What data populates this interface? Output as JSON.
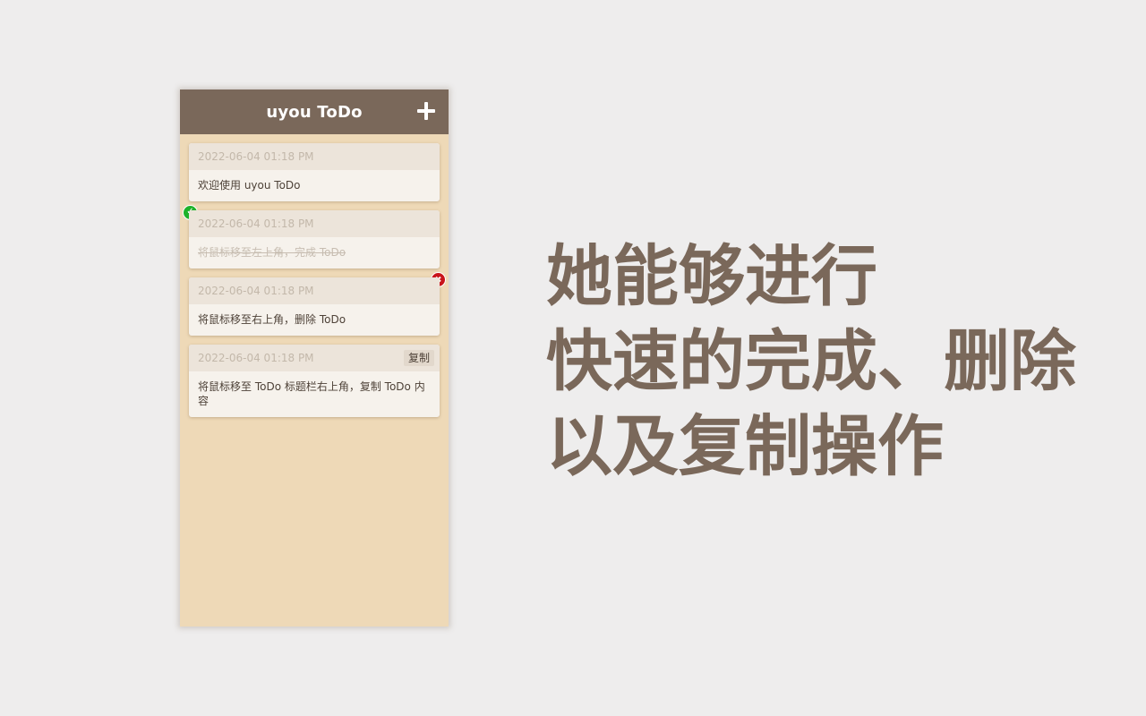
{
  "app": {
    "title": "uyou ToDo",
    "add_icon": "plus-icon"
  },
  "todos": [
    {
      "time": "2022-06-04 01:18 PM",
      "text": "欢迎使用 uyou ToDo",
      "done": false
    },
    {
      "time": "2022-06-04 01:18 PM",
      "text": "将鼠标移至左上角，完成 ToDo",
      "done": true,
      "hover_icon": "check-icon"
    },
    {
      "time": "2022-06-04 01:18 PM",
      "text": "将鼠标移至右上角，删除 ToDo",
      "done": false,
      "hover_icon": "close-icon"
    },
    {
      "time": "2022-06-04 01:18 PM",
      "text": "将鼠标移至 ToDo 标题栏右上角，复制 ToDo 内容",
      "done": false,
      "copy_label": "复制"
    }
  ],
  "caption": {
    "line1": "她能够进行",
    "line2": "快速的完成、删除",
    "line3": "以及复制操作"
  },
  "colors": {
    "background": "#eeeded",
    "header": "#7a685a",
    "panel": "#eed9b7",
    "card": "#f6f2ec",
    "card_head": "#ece4da",
    "complete": "#1fb22a",
    "delete": "#c9151b",
    "caption": "#7a685a"
  }
}
